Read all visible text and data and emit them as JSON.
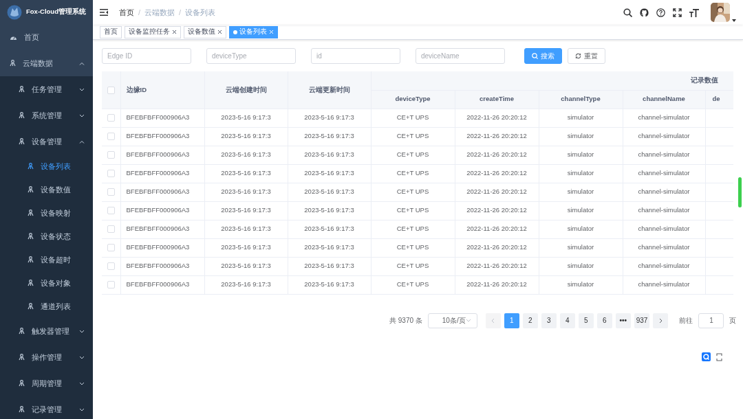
{
  "sidebar": {
    "title": "Fox-Cloud管理系统",
    "items": [
      {
        "label": "首页",
        "selected": false
      },
      {
        "label": "云端数据",
        "expanded": true,
        "selected": false,
        "children": [
          {
            "label": "任务管理",
            "expanded": false,
            "selected": false
          },
          {
            "label": "系统管理",
            "expanded": false,
            "selected": false
          },
          {
            "label": "设备管理",
            "expanded": true,
            "selected": false,
            "children": [
              {
                "label": "设备列表",
                "selected": true
              },
              {
                "label": "设备数值",
                "selected": false
              },
              {
                "label": "设备映射",
                "selected": false
              },
              {
                "label": "设备状态",
                "selected": false
              },
              {
                "label": "设备超时",
                "selected": false
              },
              {
                "label": "设备对象",
                "selected": false
              },
              {
                "label": "通道列表",
                "selected": false
              }
            ]
          },
          {
            "label": "触发器管理",
            "expanded": false,
            "selected": false
          },
          {
            "label": "操作管理",
            "expanded": false,
            "selected": false
          },
          {
            "label": "周期管理",
            "expanded": false,
            "selected": false
          },
          {
            "label": "记录管理",
            "expanded": false,
            "selected": false
          }
        ]
      }
    ]
  },
  "breadcrumb_separator": "/",
  "breadcrumb": [
    {
      "label": "首页",
      "link": true
    },
    {
      "label": "云端数据",
      "link": false
    },
    {
      "label": "设备列表",
      "link": false
    }
  ],
  "tags": [
    {
      "label": "首页",
      "closable": false,
      "selected": false
    },
    {
      "label": "设备监控任务",
      "closable": true,
      "selected": false
    },
    {
      "label": "设备数值",
      "closable": true,
      "selected": false
    },
    {
      "label": "设备列表",
      "closable": true,
      "selected": true
    }
  ],
  "filters": [
    {
      "placeholder": "Edge ID"
    },
    {
      "placeholder": "deviceType"
    },
    {
      "placeholder": "id"
    },
    {
      "placeholder": "deviceName"
    }
  ],
  "buttons": [
    {
      "label": "搜索",
      "kind": "primary"
    },
    {
      "label": "重置",
      "kind": "reset"
    }
  ],
  "table": {
    "all_checked": false,
    "columns": [
      "边缘ID",
      "云端创建时间",
      "云端更新时间"
    ],
    "group": {
      "label": "记录数值",
      "columns": [
        "deviceType",
        "createTime",
        "channelType",
        "channelName",
        "de"
      ]
    },
    "rows": [
      {
        "checked": false,
        "cells": [
          "BFEBFBFF000906A3",
          "2023-5-16 9:17:3",
          "2023-5-16 9:17:3",
          "CE+T UPS",
          "2022-11-26 20:20:12",
          "simulator",
          "channel-simulator"
        ]
      },
      {
        "checked": false,
        "cells": [
          "BFEBFBFF000906A3",
          "2023-5-16 9:17:3",
          "2023-5-16 9:17:3",
          "CE+T UPS",
          "2022-11-26 20:20:12",
          "simulator",
          "channel-simulator"
        ]
      },
      {
        "checked": false,
        "cells": [
          "BFEBFBFF000906A3",
          "2023-5-16 9:17:3",
          "2023-5-16 9:17:3",
          "CE+T UPS",
          "2022-11-26 20:20:12",
          "simulator",
          "channel-simulator"
        ]
      },
      {
        "checked": false,
        "cells": [
          "BFEBFBFF000906A3",
          "2023-5-16 9:17:3",
          "2023-5-16 9:17:3",
          "CE+T UPS",
          "2022-11-26 20:20:12",
          "simulator",
          "channel-simulator"
        ]
      },
      {
        "checked": false,
        "cells": [
          "BFEBFBFF000906A3",
          "2023-5-16 9:17:3",
          "2023-5-16 9:17:3",
          "CE+T UPS",
          "2022-11-26 20:20:12",
          "simulator",
          "channel-simulator"
        ]
      },
      {
        "checked": false,
        "cells": [
          "BFEBFBFF000906A3",
          "2023-5-16 9:17:3",
          "2023-5-16 9:17:3",
          "CE+T UPS",
          "2022-11-26 20:20:12",
          "simulator",
          "channel-simulator"
        ]
      },
      {
        "checked": false,
        "cells": [
          "BFEBFBFF000906A3",
          "2023-5-16 9:17:3",
          "2023-5-16 9:17:3",
          "CE+T UPS",
          "2022-11-26 20:20:12",
          "simulator",
          "channel-simulator"
        ]
      },
      {
        "checked": false,
        "cells": [
          "BFEBFBFF000906A3",
          "2023-5-16 9:17:3",
          "2023-5-16 9:17:3",
          "CE+T UPS",
          "2022-11-26 20:20:12",
          "simulator",
          "channel-simulator"
        ]
      },
      {
        "checked": false,
        "cells": [
          "BFEBFBFF000906A3",
          "2023-5-16 9:17:3",
          "2023-5-16 9:17:3",
          "CE+T UPS",
          "2022-11-26 20:20:12",
          "simulator",
          "channel-simulator"
        ]
      },
      {
        "checked": false,
        "cells": [
          "BFEBFBFF000906A3",
          "2023-5-16 9:17:3",
          "2023-5-16 9:17:3",
          "CE+T UPS",
          "2022-11-26 20:20:12",
          "simulator",
          "channel-simulator"
        ]
      }
    ]
  },
  "pagination": {
    "total": "共 9370 条",
    "page_size": "10条/页",
    "prev": {
      "disabled": true
    },
    "next": {
      "disabled": false
    },
    "pages": [
      {
        "label": "1",
        "kind": "page",
        "selected": true
      },
      {
        "label": "2",
        "kind": "page",
        "selected": false
      },
      {
        "label": "3",
        "kind": "page",
        "selected": false
      },
      {
        "label": "4",
        "kind": "page",
        "selected": false
      },
      {
        "label": "5",
        "kind": "page",
        "selected": false
      },
      {
        "label": "6",
        "kind": "page",
        "selected": false
      },
      {
        "label": "•••",
        "kind": "more",
        "selected": false
      },
      {
        "label": "937",
        "kind": "page",
        "selected": false
      }
    ],
    "jump_label": "前往",
    "jump_value": "1",
    "jump_suffix": "页"
  }
}
